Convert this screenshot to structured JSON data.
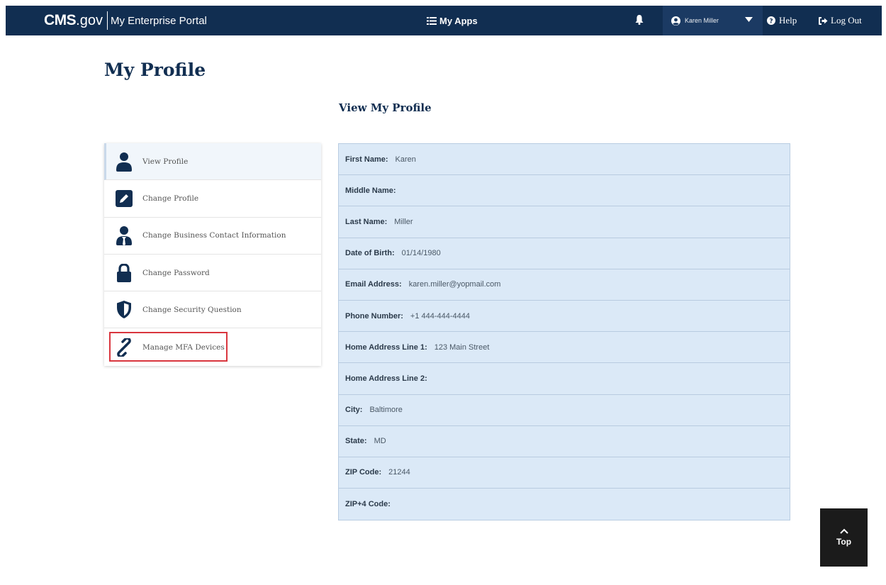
{
  "navbar": {
    "brand_cms": "CMS",
    "brand_gov": ".gov",
    "portal_name": "My Enterprise Portal",
    "my_apps_label": "My Apps",
    "user_name": "Karen Miller",
    "help_label": "Help",
    "logout_label": "Log Out",
    "background_color": "#112e51"
  },
  "page": {
    "title": "My Profile",
    "section_title": "View My Profile"
  },
  "sidebar": {
    "items": [
      {
        "label": "View Profile",
        "icon": "user-icon",
        "active": true
      },
      {
        "label": "Change Profile",
        "icon": "edit-icon"
      },
      {
        "label": "Change Business Contact Information",
        "icon": "business-user-icon"
      },
      {
        "label": "Change Password",
        "icon": "lock-icon"
      },
      {
        "label": "Change Security Question",
        "icon": "shield-icon"
      },
      {
        "label": "Manage MFA Devices",
        "icon": "link-icon",
        "highlighted": true
      }
    ]
  },
  "profile": {
    "fields": [
      {
        "label": "First Name:",
        "value": "Karen"
      },
      {
        "label": "Middle Name:",
        "value": ""
      },
      {
        "label": "Last Name:",
        "value": "Miller"
      },
      {
        "label": "Date of Birth:",
        "value": "01/14/1980"
      },
      {
        "label": "Email Address:",
        "value": "karen.miller@yopmail.com"
      },
      {
        "label": "Phone Number:",
        "value": "+1 444-444-4444"
      },
      {
        "label": "Home Address Line 1:",
        "value": "123 Main Street"
      },
      {
        "label": "Home Address Line 2:",
        "value": ""
      },
      {
        "label": "City:",
        "value": "Baltimore"
      },
      {
        "label": "State:",
        "value": "MD"
      },
      {
        "label": "ZIP Code:",
        "value": "21244"
      },
      {
        "label": "ZIP+4 Code:",
        "value": ""
      }
    ]
  },
  "back_to_top": {
    "label": "Top"
  }
}
